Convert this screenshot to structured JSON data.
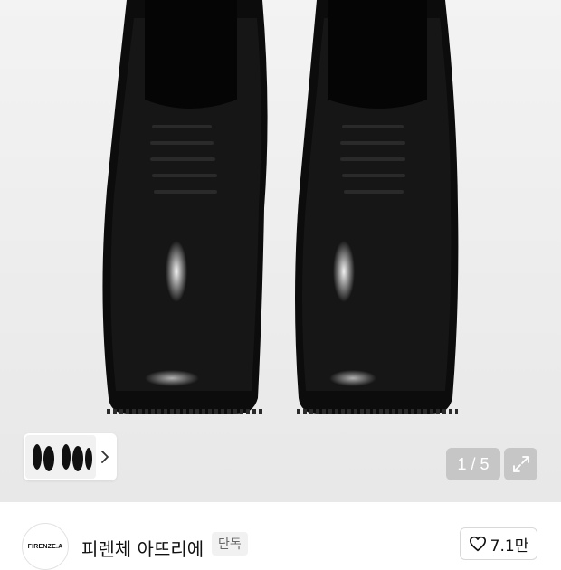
{
  "gallery": {
    "current": "1",
    "separator": "/",
    "total": "5",
    "image_subject": "black leather derby shoes",
    "thumbnail_icon": "chevron-right-icon",
    "expand_icon": "expand-arrows-icon"
  },
  "brand": {
    "logo_text": "FIRENZE.A",
    "name": "피렌체 아뜨리에",
    "tag": "단독"
  },
  "like": {
    "icon": "heart-outline-icon",
    "count": "7.1만"
  },
  "colors": {
    "hero_bg": "#ececec",
    "counter_bg": "#aaaaaa",
    "text": "#111111"
  }
}
